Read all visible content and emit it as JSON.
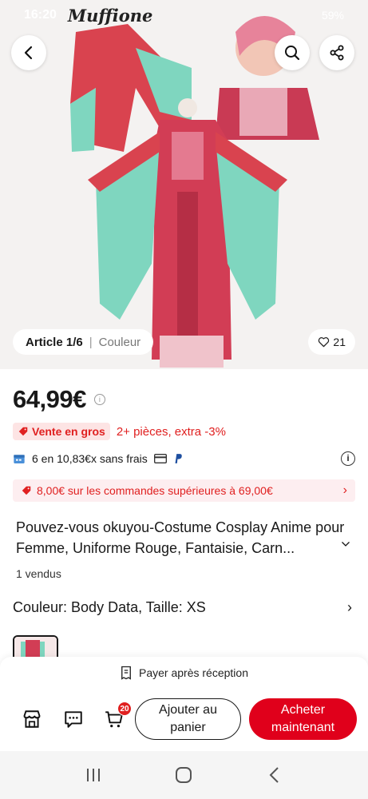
{
  "status_bar": {
    "time": "16:20",
    "brand_overlay": "Muffione",
    "battery": "59%"
  },
  "hero": {
    "article_count": "Article 1/6",
    "article_label": "Couleur",
    "likes": "21"
  },
  "product": {
    "price": "64,99€",
    "promo_badge": "Vente en gros",
    "promo_text": "2+ pièces, extra -3%",
    "installments": "6 en 10,83€x sans frais",
    "coupon": "8,00€ sur les commandes supérieures à 69,00€",
    "title": "Pouvez-vous okuyou-Costume Cosplay Anime pour Femme, Uniforme Rouge, Fantaisie, Carn...",
    "sold": "1 vendus",
    "variant": "Couleur: Body Data, Taille: XS"
  },
  "bottom": {
    "pay_later": "Payer après réception",
    "cart_count": "20",
    "add_to_cart": "Ajouter au panier",
    "buy_now": "Acheter maintenant"
  },
  "colors": {
    "accent": "#e0001b",
    "promo": "#e02020",
    "coupon_bg": "#fdeef0"
  },
  "icons": {
    "back": "chevron-left-icon",
    "search": "search-icon",
    "share": "share-icon",
    "heart": "heart-icon",
    "store": "store-icon",
    "chat": "chat-icon",
    "cart": "cart-icon"
  }
}
